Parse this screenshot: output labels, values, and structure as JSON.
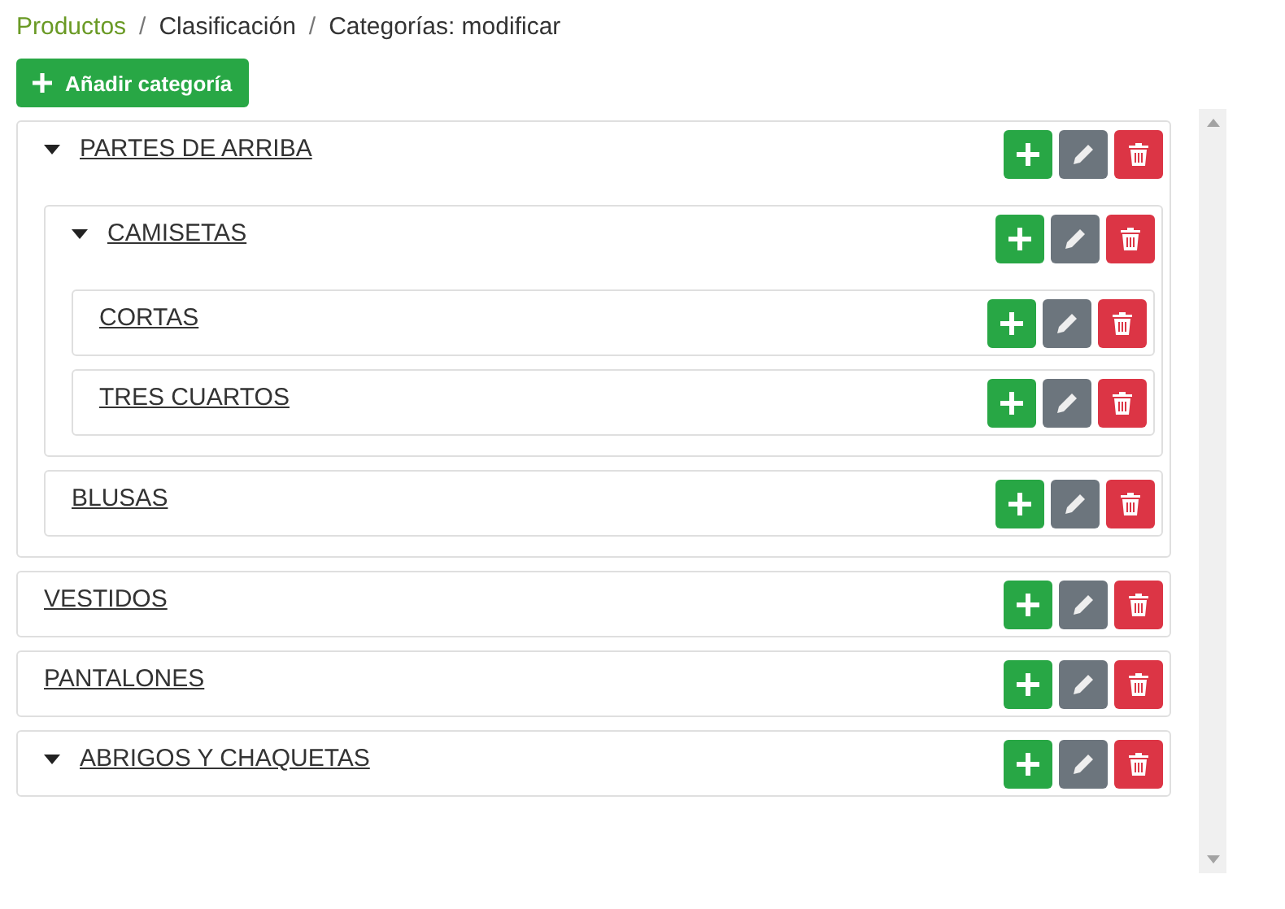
{
  "breadcrumb": {
    "separator": "/",
    "items": [
      {
        "label": "Productos",
        "kind": "link"
      },
      {
        "label": "Clasificación",
        "kind": "text"
      },
      {
        "label": "Categorías: modificar",
        "kind": "text"
      }
    ]
  },
  "add_button": {
    "label": "Añadir categoría"
  },
  "categories": [
    {
      "name": "PARTES DE ARRIBA",
      "kind": "group",
      "children": [
        {
          "name": "CAMISETAS",
          "kind": "group",
          "children": [
            {
              "name": "CORTAS",
              "kind": "leaf"
            },
            {
              "name": "TRES CUARTOS",
              "kind": "leaf"
            }
          ]
        },
        {
          "name": "BLUSAS",
          "kind": "leaf"
        }
      ]
    },
    {
      "name": "VESTIDOS",
      "kind": "leaf"
    },
    {
      "name": "PANTALONES",
      "kind": "leaf"
    },
    {
      "name": "ABRIGOS Y CHAQUETAS",
      "kind": "group"
    }
  ]
}
